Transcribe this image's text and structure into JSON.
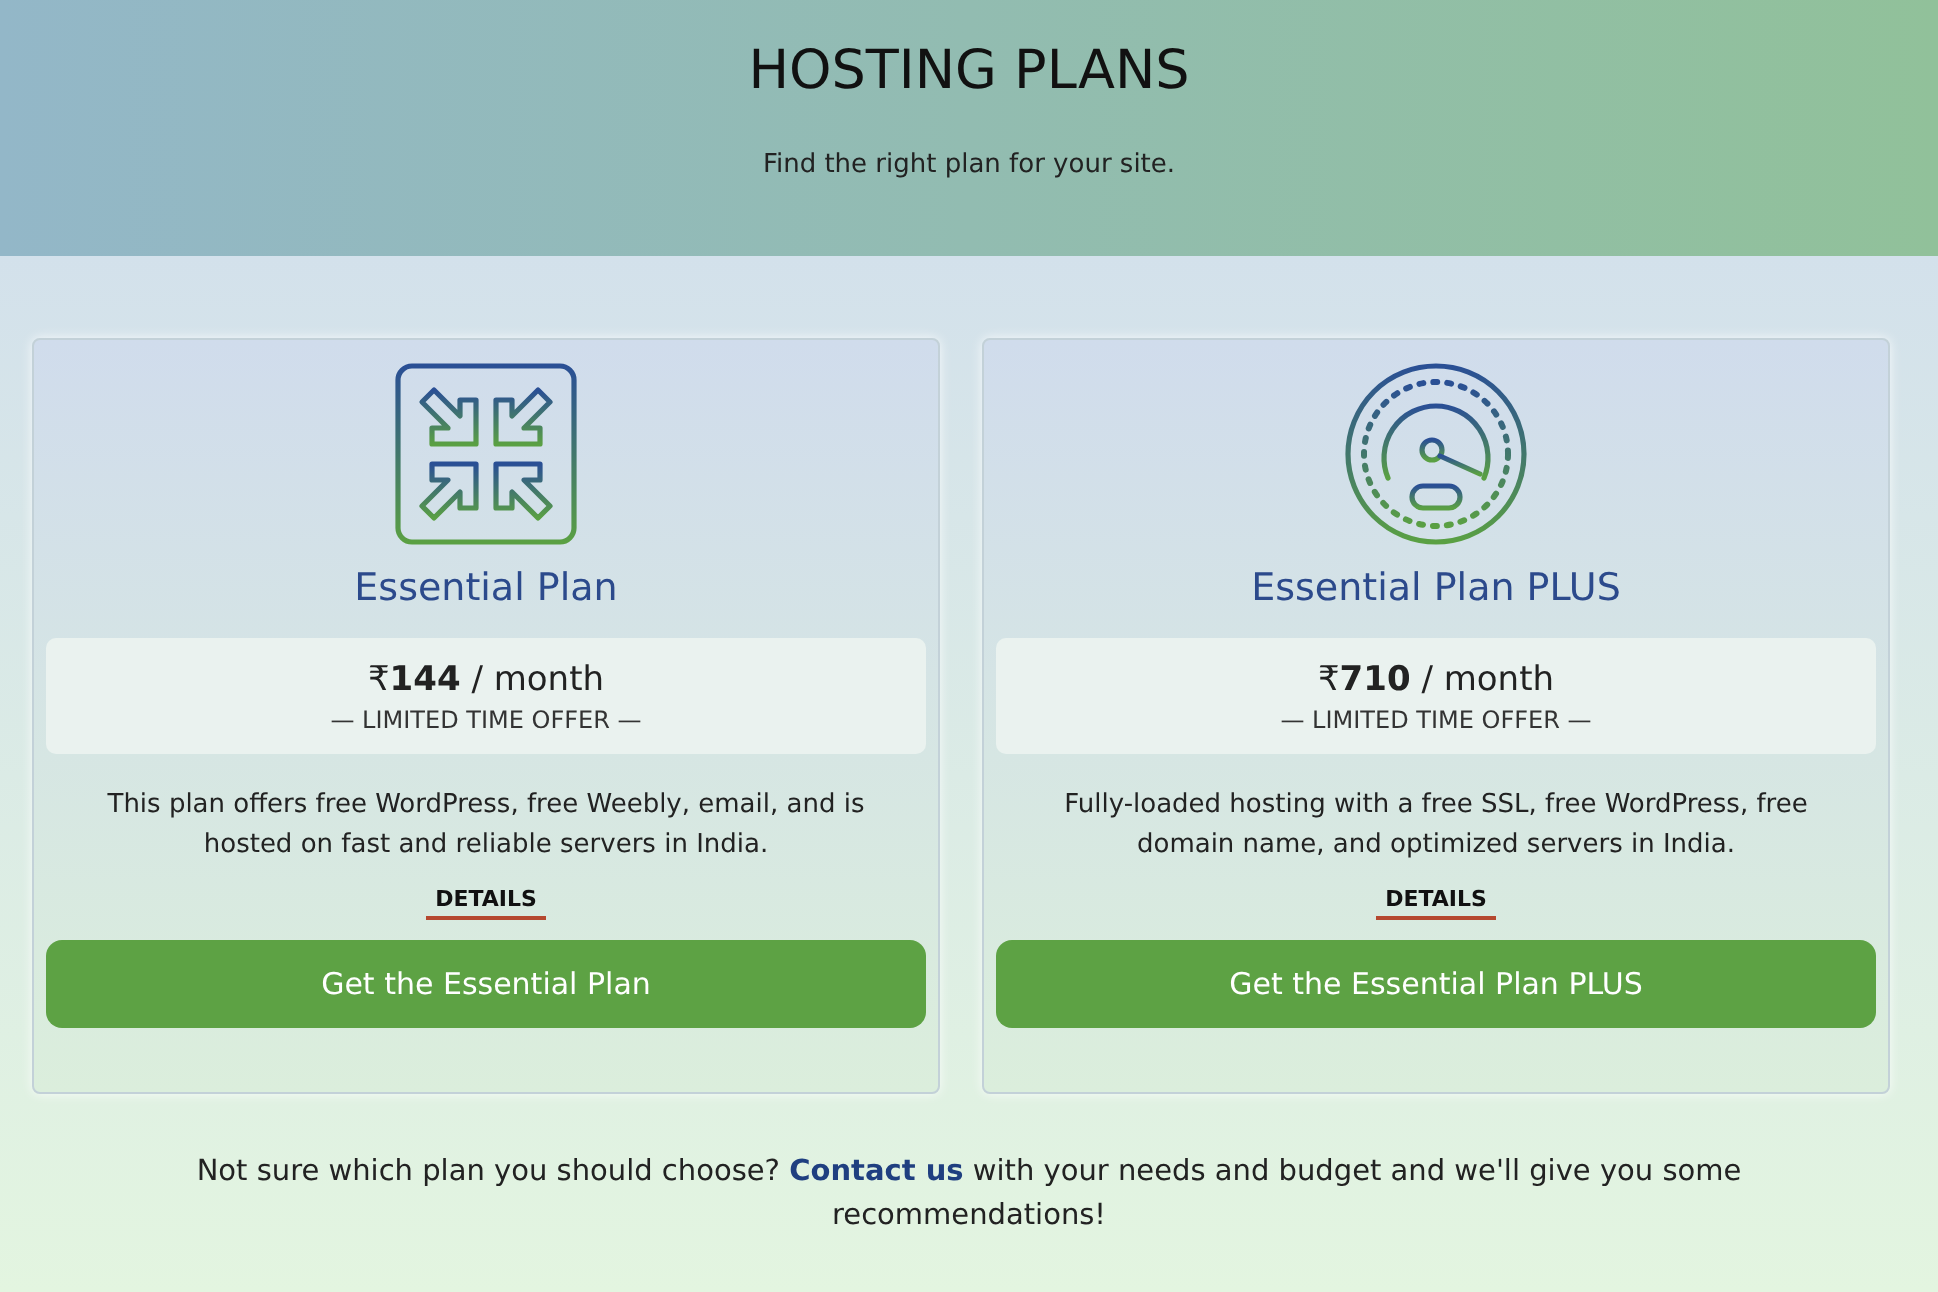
{
  "header": {
    "title": "HOSTING PLANS",
    "subtitle": "Find the right plan for your site."
  },
  "plans": [
    {
      "kind": "compress",
      "name": "Essential Plan",
      "price": "₹**144** / month",
      "offer": "— LIMITED TIME OFFER —",
      "description": "This plan offers free WordPress, free Weebly, email, and is hosted on fast and reliable servers in India.",
      "details": "DETAILS",
      "button": "Get the Essential Plan"
    },
    {
      "kind": "speedometer",
      "name": "Essential Plan PLUS",
      "price": "₹**710** / month",
      "offer": "— LIMITED TIME OFFER —",
      "description": "Fully-loaded hosting with a free SSL, free WordPress, free domain name, and optimized servers in India.",
      "details": "DETAILS",
      "button": "Get the Essential Plan PLUS"
    }
  ],
  "footer": {
    "before": "Not sure which plan you should choose?",
    "link": "Contact us",
    "after": "with your needs and budget and we'll give you some recommendations!"
  }
}
